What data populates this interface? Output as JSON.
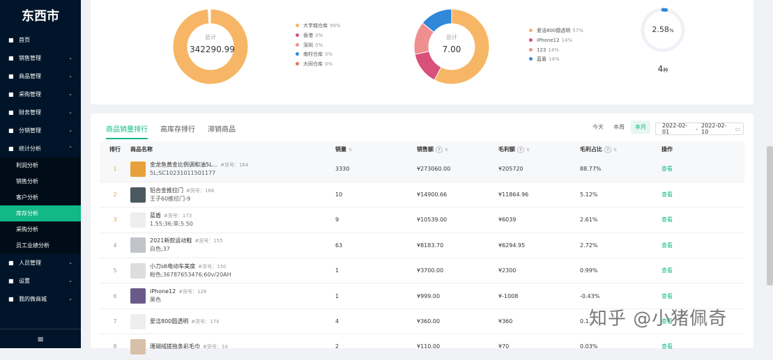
{
  "sidebar": {
    "logo": "东西市",
    "items": [
      {
        "label": "首页",
        "icon": "home-icon"
      },
      {
        "label": "销售管理",
        "icon": "cart-icon"
      },
      {
        "label": "商品管理",
        "icon": "box-icon"
      },
      {
        "label": "采购管理",
        "icon": "clipboard-icon"
      },
      {
        "label": "财务管理",
        "icon": "money-icon"
      },
      {
        "label": "分销管理",
        "icon": "share-icon"
      },
      {
        "label": "统计分析",
        "icon": "chart-icon"
      }
    ],
    "subitems": [
      "利润分析",
      "销售分析",
      "客户分析",
      "库存分析",
      "采购分析",
      "员工业绩分析"
    ],
    "items2": [
      {
        "label": "人员管理",
        "icon": "user-icon"
      },
      {
        "label": "设置",
        "icon": "gear-icon"
      },
      {
        "label": "我的微商城",
        "icon": "store-icon"
      }
    ]
  },
  "donut1": {
    "center_label": "总计",
    "center_value": "342290.99",
    "legend": [
      {
        "name": "大学城仓库",
        "pct": "99%",
        "color": "#f7b665"
      },
      {
        "name": "香港",
        "pct": "0%",
        "color": "#d9507a"
      },
      {
        "name": "深圳",
        "pct": "0%",
        "color": "#f08f8f"
      },
      {
        "name": "南村仓库",
        "pct": "0%",
        "color": "#2f88d8"
      },
      {
        "name": "大同仓库",
        "pct": "0%",
        "color": "#e0785a"
      }
    ],
    "values": [
      99,
      0.3,
      0.3,
      0.2,
      0.2
    ]
  },
  "donut2": {
    "center_label": "总计",
    "center_value": "7.00",
    "legend": [
      {
        "name": "爱洁800圆透明",
        "pct": "57%",
        "color": "#f7b665"
      },
      {
        "name": "iPhone12",
        "pct": "14%",
        "color": "#d9507a"
      },
      {
        "name": "123",
        "pct": "14%",
        "color": "#f08f8f"
      },
      {
        "name": "蓝盾",
        "pct": "14%",
        "color": "#2f88d8"
      }
    ],
    "values": [
      57,
      14,
      14,
      14
    ]
  },
  "gauge": {
    "value_num": "2.58",
    "value_unit": "%",
    "count_num": "4",
    "count_unit": "种",
    "fraction": 0.0258
  },
  "tabs": [
    "商品销量排行",
    "高库存排行",
    "滞销商品"
  ],
  "filters": [
    "今天",
    "本周",
    "本月"
  ],
  "date": {
    "start": "2022-02-01",
    "sep": "-",
    "end": "2022-02-10"
  },
  "table": {
    "headers": [
      "排行",
      "商品名称",
      "销量",
      "销售额",
      "毛利额",
      "毛利占比",
      "操作"
    ],
    "rows": [
      {
        "rank": "1",
        "name": "金龙鱼黄金比例调和油5L...",
        "code": "#货号：164",
        "sku": "5L;SC10231011501177",
        "qty": "3330",
        "sales": "¥273060.00",
        "profit": "¥205720",
        "ratio": "88.77%",
        "op": "查看",
        "img": "#e8a13b"
      },
      {
        "rank": "2",
        "name": "铝合金推拉门",
        "code": "#货号：168",
        "sku": "王子60推拉门-9",
        "qty": "10",
        "sales": "¥14900.66",
        "profit": "¥11864.96",
        "ratio": "5.12%",
        "op": "查看",
        "img": "#4a5a60"
      },
      {
        "rank": "3",
        "name": "蓝盾",
        "code": "#货号：173",
        "sku": "1.55;36;非;5.50",
        "qty": "9",
        "sales": "¥10539.00",
        "profit": "¥6039",
        "ratio": "2.61%",
        "op": "查看",
        "img": "#eeeeee"
      },
      {
        "rank": "4",
        "name": "2021新款运动鞋",
        "code": "#货号：155",
        "sku": "白色;37",
        "qty": "63",
        "sales": "¥8183.70",
        "profit": "¥6294.95",
        "ratio": "2.72%",
        "op": "查看",
        "img": "#c0c4c8"
      },
      {
        "rank": "5",
        "name": "小刀s6电动车美度",
        "code": "#货号：150",
        "sku": "粉色;36787653476;60v/20AH",
        "qty": "1",
        "sales": "¥3700.00",
        "profit": "¥2300",
        "ratio": "0.99%",
        "op": "查看",
        "img": "#dddddd"
      },
      {
        "rank": "6",
        "name": "iPhone12",
        "code": "#货号：126",
        "sku": "黑色",
        "qty": "1",
        "sales": "¥999.00",
        "profit": "¥-1008",
        "ratio": "-0.43%",
        "op": "查看",
        "img": "#6a5a8a"
      },
      {
        "rank": "7",
        "name": "爱洁800圆透明",
        "code": "#货号：174",
        "sku": "",
        "qty": "4",
        "sales": "¥360.00",
        "profit": "¥360",
        "ratio": "0.1…",
        "op": "查看",
        "img": "#eeeeee"
      },
      {
        "rank": "8",
        "name": "珊瑚绒搓拖条彩毛巾",
        "code": "#货号：14",
        "sku": "",
        "qty": "2",
        "sales": "¥110.00",
        "profit": "¥70",
        "ratio": "0.03%",
        "op": "查看",
        "img": "#d8c0a8"
      }
    ]
  },
  "watermark": "知乎 @小猪佩奇"
}
